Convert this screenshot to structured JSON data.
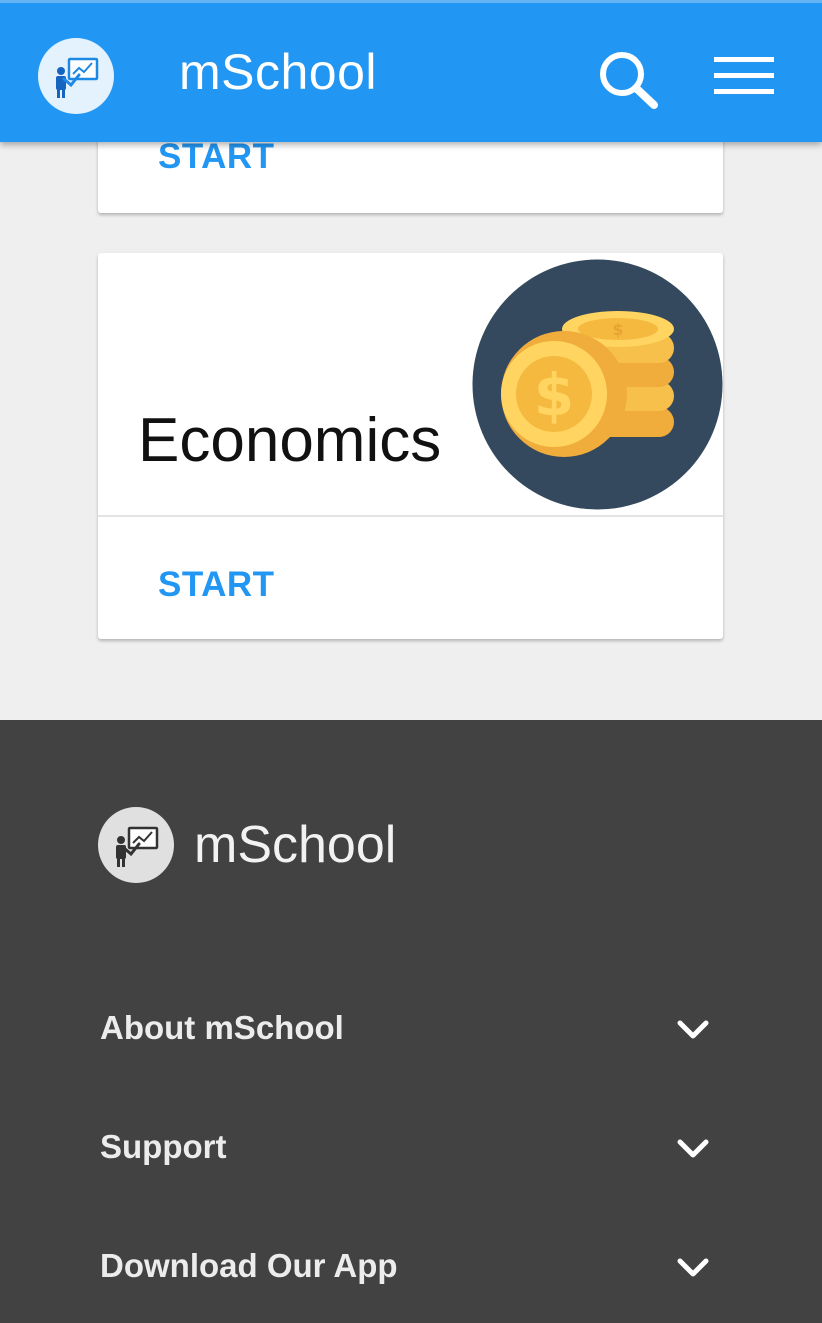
{
  "header": {
    "app_title": "mSchool",
    "logo_icon": "teacher-presentation-icon",
    "search_icon": "search-icon",
    "menu_icon": "hamburger-menu-icon",
    "accent_color": "#2196f3"
  },
  "cards": [
    {
      "start_label": "START"
    },
    {
      "subject": "Economics",
      "image_icon": "gold-coins-icon",
      "start_label": "START"
    }
  ],
  "footer": {
    "brand": "mSchool",
    "logo_icon": "teacher-presentation-icon",
    "sections": [
      {
        "label": "About mSchool",
        "icon": "chevron-down-icon"
      },
      {
        "label": "Support",
        "icon": "chevron-down-icon"
      },
      {
        "label": "Download Our App",
        "icon": "chevron-down-icon"
      }
    ]
  }
}
